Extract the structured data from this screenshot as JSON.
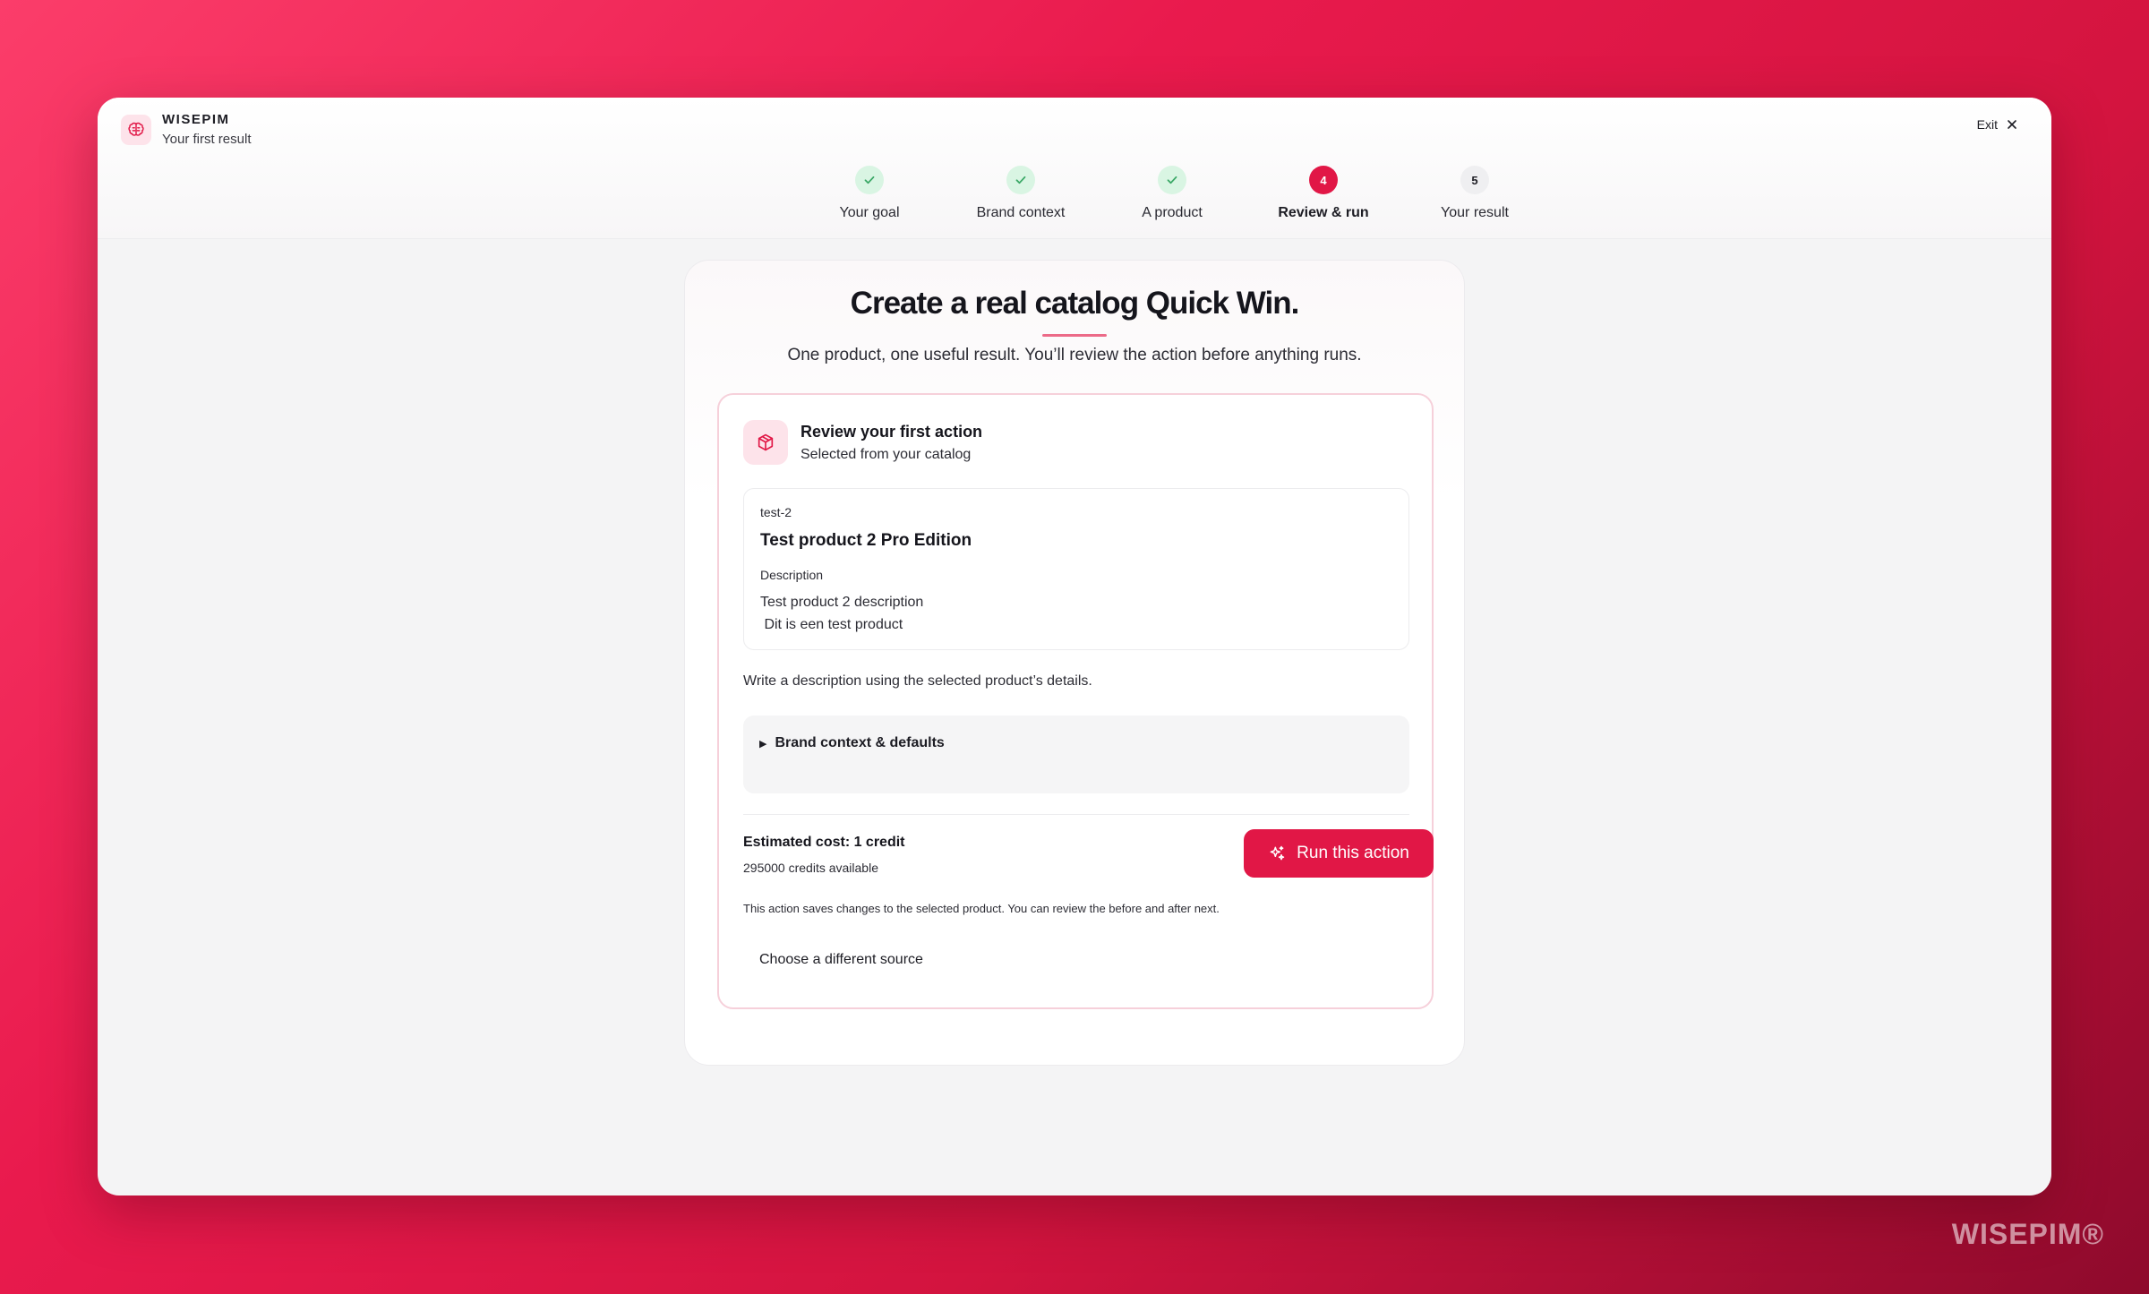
{
  "brand": {
    "name": "WISEPIM",
    "subtitle": "Your first result",
    "logo_icon": "brain-icon"
  },
  "header": {
    "exit_label": "Exit",
    "exit_icon": "close-icon"
  },
  "steps": [
    {
      "number": "1",
      "label": "Your goal",
      "status": "done"
    },
    {
      "number": "2",
      "label": "Brand context",
      "status": "done"
    },
    {
      "number": "3",
      "label": "A product",
      "status": "done"
    },
    {
      "number": "4",
      "label": "Review & run",
      "status": "active"
    },
    {
      "number": "5",
      "label": "Your result",
      "status": "todo"
    }
  ],
  "main": {
    "title": "Create a real catalog Quick Win.",
    "subtitle": "One product, one useful result. You’ll review the action before anything runs.",
    "action": {
      "icon": "package-icon",
      "title": "Review your first action",
      "subtitle": "Selected from your catalog"
    },
    "product": {
      "sku": "test-2",
      "name": "Test product 2 Pro Edition",
      "description_label": "Description",
      "description": "Test product 2 description\n Dit is een test product"
    },
    "instruction": "Write a description using the selected product’s details.",
    "details_toggle": "Brand context & defaults",
    "cost": {
      "title": "Estimated cost: 1 credit",
      "available": "295000 credits available"
    },
    "run_button": "Run this action",
    "notice": "This action saves changes to the selected product. You can review the before and after next.",
    "alt_link": "Choose a different source"
  },
  "watermark": "WISEPIM®",
  "colors": {
    "accent": "#e11746",
    "done": "#d9f5e3",
    "check": "#3aa866"
  }
}
